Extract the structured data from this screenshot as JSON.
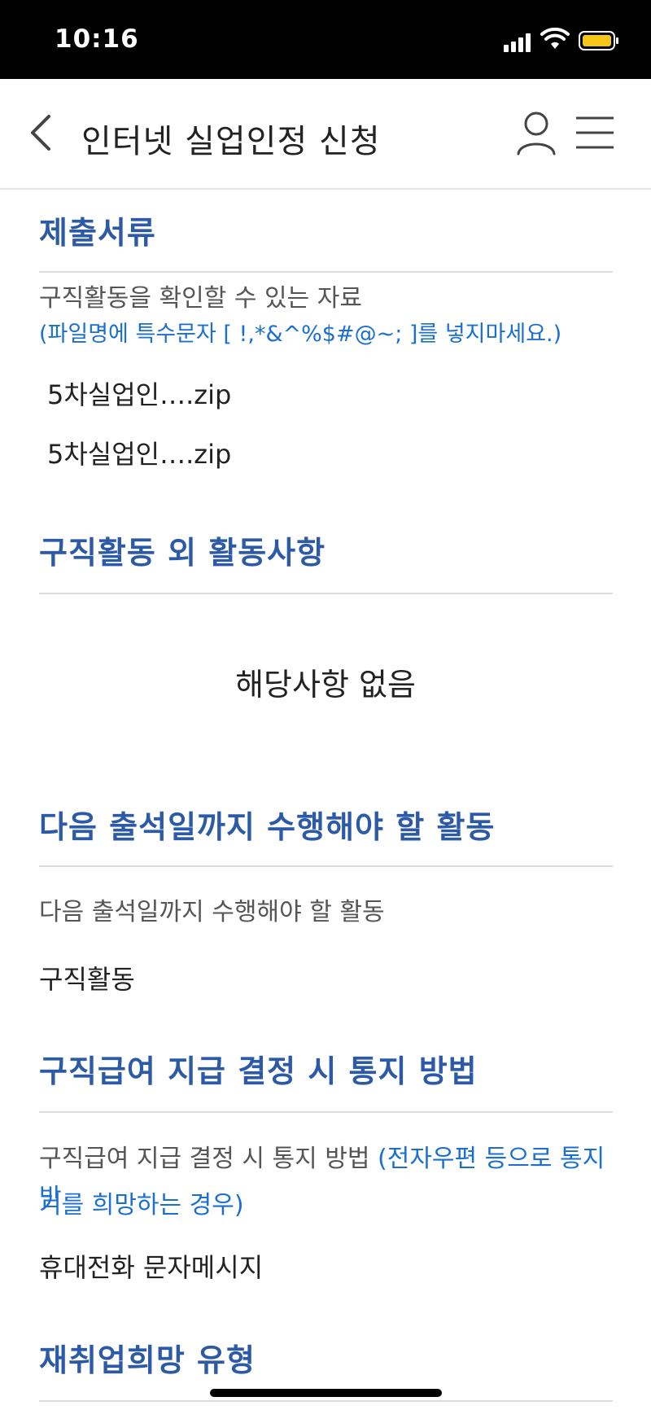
{
  "status_bar": {
    "time": "10:16"
  },
  "header": {
    "title": "인터넷 실업인정 신청"
  },
  "documents": {
    "title": "제출서류",
    "label": "구직활동을 확인할 수 있는 자료",
    "note": "(파일명에 특수문자 [ !,*&^%$#@~; ]를 넣지마세요.)",
    "files": [
      "5차실업인….zip",
      "5차실업인….zip"
    ]
  },
  "other_activities": {
    "title": "구직활동 외 활동사항",
    "value": "해당사항 없음"
  },
  "next_activity": {
    "title": "다음 출석일까지 수행해야 할 활동",
    "label": "다음 출석일까지 수행해야 할 활동",
    "value": "구직활동"
  },
  "notification": {
    "title": "구직급여 지급 결정 시 통지 방법",
    "label": "구직급여 지급 결정 시 통지 방법",
    "note_part1": "(전자우편 등으로 통지 받",
    "note_part2": "기를 희망하는 경우)",
    "value": "휴대전화 문자메시지"
  },
  "reemployment": {
    "title": "재취업희망 유형"
  },
  "colors": {
    "section_title": "#2c5aa7",
    "note": "#1a6fd1",
    "status_bar_bg": "#000000",
    "battery": "#f5c518"
  }
}
